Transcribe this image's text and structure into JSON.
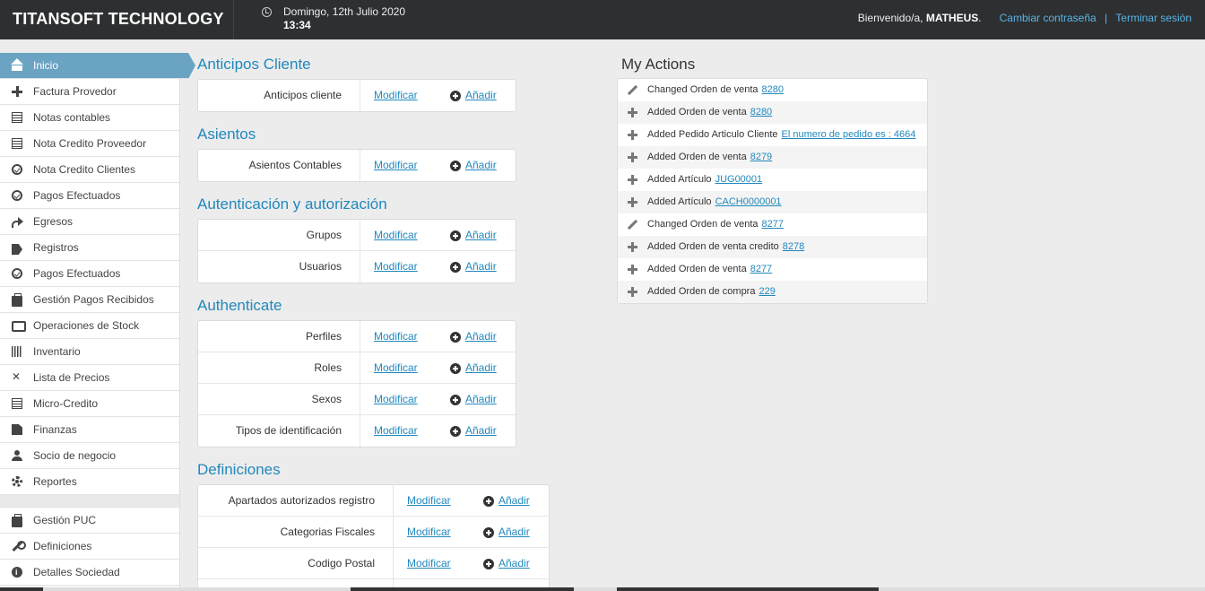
{
  "header": {
    "brand": "TITANSOFT TECHNOLOGY",
    "date": "Domingo, 12th Julio 2020",
    "time": "13:34",
    "welcome_prefix": "Bienvenido/a,",
    "username": "MATHEUS",
    "welcome_suffix": ".",
    "change_password": "Cambiar contraseña",
    "separator": "|",
    "logout": "Terminar sesión"
  },
  "sidebar": {
    "items": [
      {
        "label": "Inicio",
        "icon": "home-icon"
      },
      {
        "label": "Factura Provedor",
        "icon": "plus-icon"
      },
      {
        "label": "Notas contables",
        "icon": "list-icon"
      },
      {
        "label": "Nota Credito Proveedor",
        "icon": "list-icon"
      },
      {
        "label": "Nota Credito Clientes",
        "icon": "check-circle-icon"
      },
      {
        "label": "Pagos Efectuados",
        "icon": "check-circle-icon"
      },
      {
        "label": "Egresos",
        "icon": "share-arrow-icon"
      },
      {
        "label": "Registros",
        "icon": "tags-icon"
      },
      {
        "label": "Pagos Efectuados",
        "icon": "check-circle-icon"
      },
      {
        "label": "Gestión Pagos Recibidos",
        "icon": "briefcase-icon"
      },
      {
        "label": "Operaciones de Stock",
        "icon": "retweet-icon"
      },
      {
        "label": "Inventario",
        "icon": "barcode-icon"
      },
      {
        "label": "Lista de Precios",
        "icon": "shuffle-icon"
      },
      {
        "label": "Micro-Credito",
        "icon": "list-icon"
      },
      {
        "label": "Finanzas",
        "icon": "file-icon"
      },
      {
        "label": "Socio de negocio",
        "icon": "user-icon"
      },
      {
        "label": "Reportes",
        "icon": "gear-icon"
      }
    ],
    "secondary_items": [
      {
        "label": "Gestión PUC",
        "icon": "briefcase-icon"
      },
      {
        "label": "Definiciones",
        "icon": "wrench-icon"
      },
      {
        "label": "Detalles Sociedad",
        "icon": "info-icon"
      }
    ]
  },
  "modules": {
    "modify_label": "Modificar",
    "add_label": "Añadir",
    "anticipos": {
      "title": "Anticipos Cliente",
      "rows": [
        "Anticipos cliente"
      ]
    },
    "asientos": {
      "title": "Asientos",
      "rows": [
        "Asientos Contables"
      ]
    },
    "auth": {
      "title": "Autenticación y autorización",
      "rows": [
        "Grupos",
        "Usuarios"
      ]
    },
    "authenticate": {
      "title": "Authenticate",
      "rows": [
        "Perfiles",
        "Roles",
        "Sexos",
        "Tipos de identificación"
      ]
    },
    "definiciones": {
      "title": "Definiciones",
      "rows": [
        "Apartados autorizados registro",
        "Categorias Fiscales",
        "Codigo Postal"
      ]
    }
  },
  "actions": {
    "title": "My Actions",
    "items": [
      {
        "icon": "pencil-icon",
        "text": "Changed Orden de venta",
        "link": "8280"
      },
      {
        "icon": "plus-icon",
        "text": "Added Orden de venta",
        "link": "8280"
      },
      {
        "icon": "plus-icon",
        "text": "Added Pedido Articulo Cliente",
        "link": "El numero de pedido es : 4664"
      },
      {
        "icon": "plus-icon",
        "text": "Added Orden de venta",
        "link": "8279"
      },
      {
        "icon": "plus-icon",
        "text": "Added Artículo",
        "link": "JUG00001"
      },
      {
        "icon": "plus-icon",
        "text": "Added Artículo",
        "link": "CACH0000001"
      },
      {
        "icon": "pencil-icon",
        "text": "Changed Orden de venta",
        "link": "8277"
      },
      {
        "icon": "plus-icon",
        "text": "Added Orden de venta credito",
        "link": "8278"
      },
      {
        "icon": "plus-icon",
        "text": "Added Orden de venta",
        "link": "8277"
      },
      {
        "icon": "plus-icon",
        "text": "Added Orden de compra",
        "link": "229"
      }
    ]
  },
  "colors": {
    "accent": "#2188bd",
    "header_bg": "#2d2f31",
    "active_item": "#6aa4c2"
  }
}
